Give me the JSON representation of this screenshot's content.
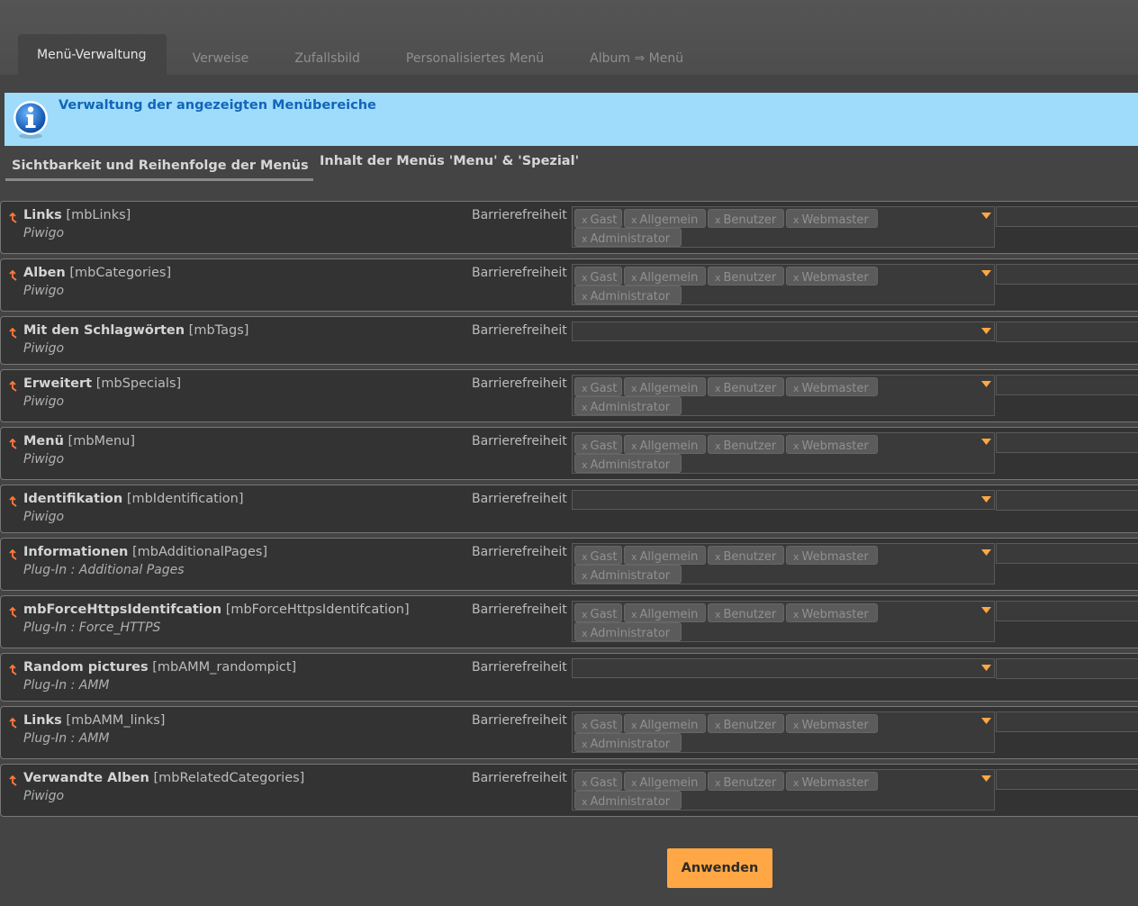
{
  "tabs": [
    {
      "label": "Menü-Verwaltung",
      "active": true
    },
    {
      "label": "Verweise",
      "active": false
    },
    {
      "label": "Zufallsbild",
      "active": false
    },
    {
      "label": "Personalisiertes Menü",
      "active": false
    },
    {
      "label": "Album ⇒ Menü",
      "active": false
    }
  ],
  "info": {
    "text": "Verwaltung der angezeigten Menübereiche",
    "icon": "info-icon"
  },
  "subtabs": {
    "visibility": "Sichtbarkeit und Reihenfolge der Menüs",
    "content": "Inhalt der Menüs 'Menu' & 'Spezial'"
  },
  "access_label": "Barrierefreiheit",
  "chip_remove": "x",
  "groups": [
    "Gast",
    "Allgemein",
    "Benutzer",
    "Webmaster",
    "Administrator"
  ],
  "blocks": [
    {
      "title": "Links",
      "id": "[mbLinks]",
      "source": "Piwigo",
      "groups_shown": true
    },
    {
      "title": "Alben",
      "id": "[mbCategories]",
      "source": "Piwigo",
      "groups_shown": true
    },
    {
      "title": "Mit den Schlagwörten",
      "id": "[mbTags]",
      "source": "Piwigo",
      "groups_shown": false
    },
    {
      "title": "Erweitert",
      "id": "[mbSpecials]",
      "source": "Piwigo",
      "groups_shown": true
    },
    {
      "title": "Menü",
      "id": "[mbMenu]",
      "source": "Piwigo",
      "groups_shown": true
    },
    {
      "title": "Identifikation",
      "id": "[mbIdentification]",
      "source": "Piwigo",
      "groups_shown": false
    },
    {
      "title": "Informationen",
      "id": "[mbAdditionalPages]",
      "source": "Plug-In : Additional Pages",
      "groups_shown": true
    },
    {
      "title": "mbForceHttpsIdentifcation",
      "id": "[mbForceHttpsIdentifcation]",
      "source": "Plug-In : Force_HTTPS",
      "groups_shown": true
    },
    {
      "title": "Random pictures",
      "id": "[mbAMM_randompict]",
      "source": "Plug-In : AMM",
      "groups_shown": false
    },
    {
      "title": "Links",
      "id": "[mbAMM_links]",
      "source": "Plug-In : AMM",
      "groups_shown": true
    },
    {
      "title": "Verwandte Alben",
      "id": "[mbRelatedCategories]",
      "source": "Piwigo",
      "groups_shown": true
    }
  ],
  "apply_label": "Anwenden",
  "colors": {
    "accent": "#ffa744",
    "info_bg": "#9fdcfb",
    "info_text": "#1265b8",
    "drag_icon": "#ff7a3c"
  }
}
